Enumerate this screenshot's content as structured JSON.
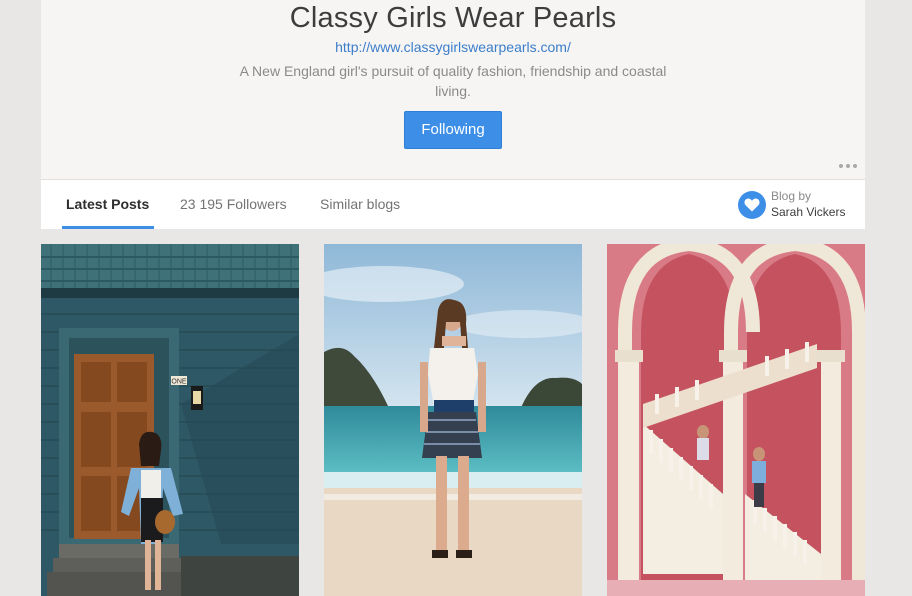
{
  "blog": {
    "title": "Classy Girls Wear Pearls",
    "url": "http://www.classygirlswearpearls.com/",
    "description": "A New England girl's pursuit of quality fashion, friendship and coastal living.",
    "follow_label": "Following"
  },
  "tabs": [
    {
      "label": "Latest Posts",
      "active": true
    },
    {
      "label": "23 195 Followers",
      "active": false
    },
    {
      "label": "Similar blogs",
      "active": false
    }
  ],
  "author": {
    "label": "Blog by",
    "name": "Sarah Vickers",
    "icon": "heart-icon"
  },
  "posts": [
    {
      "description": "woman in blue coat in front of wooden door of blue house",
      "door_sign": "ONE"
    },
    {
      "description": "woman in white top and patterned shorts on a beach"
    },
    {
      "description": "couple on staircase with white arches against pink wall"
    }
  ],
  "colors": {
    "accent": "#3d8ee6",
    "background": "#e9e7e6",
    "card": "#f6f5f4"
  }
}
